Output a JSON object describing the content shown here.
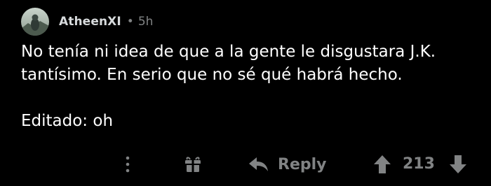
{
  "comment": {
    "author": "AtheenXI",
    "separator": "•",
    "timestamp": "5h",
    "body_line1": "No tenía ni idea de que a la gente le disgustara J.K. tantísimo. En serio que no sé qué habrá hecho.",
    "body_line2": "Editado: oh"
  },
  "actions": {
    "more_icon": "more-vertical-icon",
    "gift_icon": "gift-icon",
    "reply_label": "Reply",
    "reply_icon": "reply-arrow-icon",
    "upvote_icon": "upvote-arrow-icon",
    "score": "213",
    "downvote_icon": "downvote-arrow-icon"
  },
  "colors": {
    "background": "#000000",
    "text": "#ffffff",
    "muted": "#818384",
    "username": "#d7dadc"
  }
}
